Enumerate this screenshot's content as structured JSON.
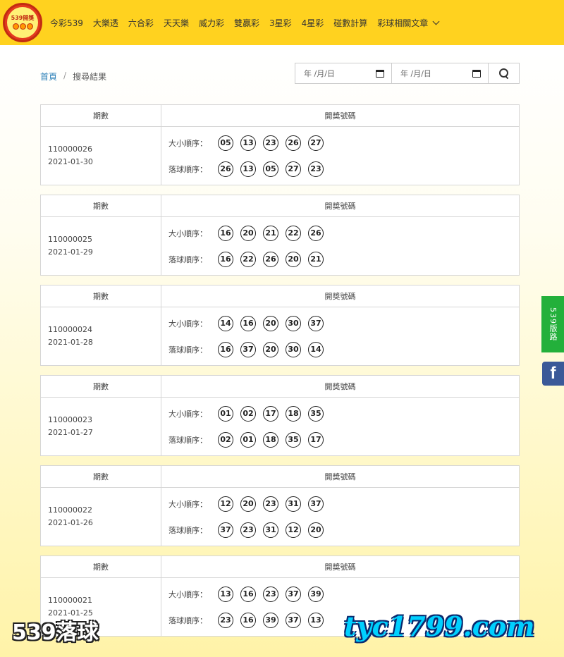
{
  "logo": {
    "text": "539開獎"
  },
  "nav": {
    "items": [
      "今彩539",
      "大樂透",
      "六合彩",
      "天天樂",
      "威力彩",
      "雙贏彩",
      "3星彩",
      "4星彩",
      "碰數計算"
    ],
    "dropdown": "彩球相關文章"
  },
  "breadcrumb": {
    "home": "首頁",
    "separator": "/",
    "current": "搜尋結果"
  },
  "search": {
    "start_placeholder": "年 /月/日",
    "end_placeholder": "年 /月/日"
  },
  "table": {
    "col_period": "期數",
    "col_numbers": "開獎號碼",
    "label_sorted": "大小順序：",
    "label_drawn": "落球順序："
  },
  "records": [
    {
      "period": "110000026",
      "date": "2021-01-30",
      "sorted": [
        "05",
        "13",
        "23",
        "26",
        "27"
      ],
      "drawn": [
        "26",
        "13",
        "05",
        "27",
        "23"
      ]
    },
    {
      "period": "110000025",
      "date": "2021-01-29",
      "sorted": [
        "16",
        "20",
        "21",
        "22",
        "26"
      ],
      "drawn": [
        "16",
        "22",
        "26",
        "20",
        "21"
      ]
    },
    {
      "period": "110000024",
      "date": "2021-01-28",
      "sorted": [
        "14",
        "16",
        "20",
        "30",
        "37"
      ],
      "drawn": [
        "16",
        "37",
        "20",
        "30",
        "14"
      ]
    },
    {
      "period": "110000023",
      "date": "2021-01-27",
      "sorted": [
        "01",
        "02",
        "17",
        "18",
        "35"
      ],
      "drawn": [
        "02",
        "01",
        "18",
        "35",
        "17"
      ]
    },
    {
      "period": "110000022",
      "date": "2021-01-26",
      "sorted": [
        "12",
        "20",
        "23",
        "31",
        "37"
      ],
      "drawn": [
        "37",
        "23",
        "31",
        "12",
        "20"
      ]
    },
    {
      "period": "110000021",
      "date": "2021-01-25",
      "sorted": [
        "13",
        "16",
        "23",
        "37",
        "39"
      ],
      "drawn": [
        "23",
        "16",
        "39",
        "37",
        "13"
      ]
    }
  ],
  "side": {
    "tab_label": "539版路",
    "facebook": "f"
  },
  "watermarks": {
    "left": "539落球",
    "right": "tyc1799.com"
  },
  "colors": {
    "navbar": "#ffd21f",
    "side_tab": "#23b03b",
    "facebook": "#3b5998",
    "link": "#2b7fb8"
  }
}
